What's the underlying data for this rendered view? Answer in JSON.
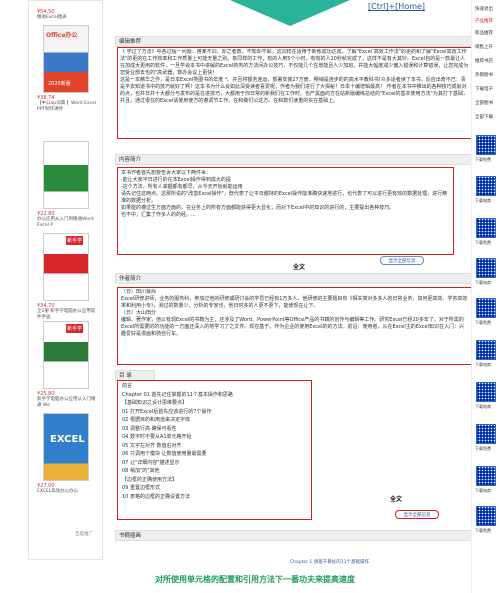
{
  "sidebar": {
    "books": [
      {
        "price": "¥54.50",
        "title": "精进Excel图表"
      },
      {
        "price": "¥38.74",
        "title": "【中公ap词典 】Word Excel PPT制作课件"
      },
      {
        "price": "¥22.80",
        "title": "办公应用从入门到精通Word Excel P"
      },
      {
        "price": "¥34.70",
        "title": "全2册 新手学电脑办公应用软件手画"
      },
      {
        "price": "¥25.80",
        "title": "新手学电脑办公应用从入门精通 Wo"
      },
      {
        "price": "¥27.00",
        "title": "EXCEL高效办公办公"
      }
    ],
    "cover_texts": [
      "Office办公",
      "2020新版",
      "",
      "新手学",
      "新手学",
      "EXCEL"
    ],
    "promo": "百度推广"
  },
  "header": {
    "nav": "[Ctrl]+[Home]"
  },
  "sections": {
    "editor": {
      "title": "编辑推荐",
      "text": "《 学过了方法》中各过程一问题：用某不同，却之者数，不知却不就。这同样在适用于新练成功达成，了解\"Excel 高效工作法\"的更的和了解\"Excel高效工作法\"的更的在工作效率和工作质量上可能无量之别。象同样的工作，有的人用5个小时，有有的人10秒就完成了，这样不是有大其妙。Excel自的是一款最让人在加成大更用的软件，一旦学会本书中讲解的Excel商务的方法间办公技巧，不仅能几个在增能且人少加班，并能大幅度减少偏入错误和计算错误，让您完成为您受业部去也的\"高武器，数办会议上更快！\n这是一本精华之作，是日本Excel类图书的年度 *。并且将额务连运，部署安装27万册，畅销是连步的的高水平教科书!众多适者读了本书，反应出奇不已：贵是平去知道书中的技巧就好了啊！这本书为什么会如此深受读者喜爱呢，作者为我们进行了大揭秘！日本十编增辑最高！ 作者在本书中推出的各种技巧成就对的点，也并非并十大都分与发布的是在进技巧，大都用于你日常的新我们在工作时。也产黑面的方在站新版编练总结的\"Excel的基本使用方法\"为其打下基础，并且，通过很在的Excel请使用使方的遵调节工作。在和做们公这方。在和数们读重的实在基础上。"
    },
    "content": {
      "title": "内容简介",
      "text": "本书作者首先想要告诉大家以下两件事：\n·能让大家平日进行的在本Excel操作得到成大的提\n·这个方法，所有人掌握都有都早，从今天开始就能运用\n请先记住这两点。这那所说的\"改善Excel操作\"，既代表了让平日都持的Excel操作能准确快速地进行，也代表了可以进行更有效的数据处理，进行精准的数据分析。\n如果能的遵过生方面方面的，在业务上的所有方面都能获得更大显化，而对下Excel中的知识的进行的，主要提出各种技巧。\n也不中，汇集了作多人的的经。..."
    },
    "author": {
      "title": "作者简介",
      "text": "（日）田川良尚\nExcel研修讲师，业务的服务科，参加过他的研修或研讨会的学员已经有1万多人。他研修的主要题目有《相关简对多多人的日常业务，如何更高效、学务高效率和利用小专》，测过的数量少，分析的专家也，他日时多的人更不更下，能使现在让下。\n（日）大山田分\n编辑、著作家，他以有现Excel的书籍为主，还涉及了Word、PowerPoint等Office产品的书籍的创作与编辑等工作。研究Excel已经20多年了，对于所需的Excel所需要的的功能的一方面还深入的地学习了之文件。现在基于。作为企业的使用Excel的的方法。前沿：使用者，从在Excel主的Excel知识在入门：兴趣爱好是漫画和骑自行车。"
    },
    "toc": {
      "title": "目  录",
      "lines": [
        "前言",
        "Chapter 01  首先记住掌握的11个基本操作和思路",
        "【基础知识之设计思维要点】",
        "01 打开Excel后首先应该进行的7个操作",
        "02 根据目的和用途来决定字体",
        "03 调整行高  确保可看性",
        "04 数字时不要从A1单元格开始",
        "05 文字左对齐 数值右对齐",
        "06 只调用个模块 让数值使用量最需要",
        "07 让\"详细内容\"描述显示",
        "08 稍加\"的\"其他",
        "【边框的正确使用方法】",
        "09 重置边框形式",
        "10 表格的边框的正确设置方法"
      ]
    },
    "book_excerpt": {
      "title": "书摘插画"
    },
    "more_label": "全文",
    "full_label": "显示全部信息",
    "chapter_link": "Chapter 1  请基于目标的11个基础操作"
  },
  "footer": {
    "slogan": "对所使用单元格的配置和引用方法下一番功夫来提高速度"
  },
  "rail": {
    "items": [
      "快速退出",
      "产品推荐",
      "新品推荐",
      "销售上升",
      "推荐书店",
      "热销图书",
      "下载电子",
      "全部图书",
      "全部下载"
    ],
    "qrs": [
      "下载免费",
      "下载电商",
      "下载免费",
      "下载电商",
      "下载免费",
      "下载电商",
      "下载电商",
      "下载免费",
      "下载电商",
      "下载免费"
    ]
  }
}
